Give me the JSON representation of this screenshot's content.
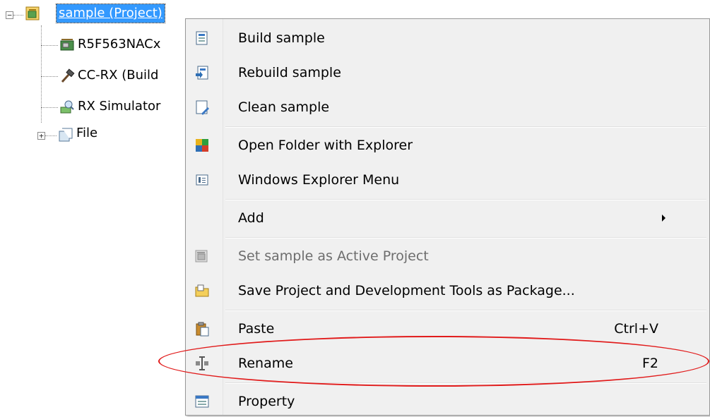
{
  "tree": {
    "root_label": "sample (Project)",
    "items": [
      {
        "label": "R5F563NACx",
        "icon": "chip-icon"
      },
      {
        "label": "CC-RX (Build",
        "icon": "hammer-icon"
      },
      {
        "label": "RX Simulator",
        "icon": "debugger-icon"
      },
      {
        "label": "File",
        "icon": "folder-file-icon"
      }
    ],
    "collapse_glyph": "−",
    "expand_glyph": "+"
  },
  "context_menu": {
    "items": [
      {
        "label": "Build sample",
        "icon": "build-icon",
        "enabled": true
      },
      {
        "label": "Rebuild sample",
        "icon": "rebuild-icon",
        "enabled": true
      },
      {
        "label": "Clean sample",
        "icon": "clean-icon",
        "enabled": true
      },
      {
        "label": "Open Folder with Explorer",
        "icon": "explorer-folder-icon",
        "enabled": true
      },
      {
        "label": "Windows Explorer Menu",
        "icon": "explorer-menu-icon",
        "enabled": true
      },
      {
        "label": "Add",
        "icon": null,
        "enabled": true,
        "submenu": true
      },
      {
        "label": "Set sample as Active Project",
        "icon": "active-project-icon",
        "enabled": false
      },
      {
        "label": "Save Project and Development Tools as Package...",
        "icon": "package-icon",
        "enabled": true
      },
      {
        "label": "Paste",
        "icon": "paste-icon",
        "enabled": true,
        "shortcut": "Ctrl+V"
      },
      {
        "label": "Rename",
        "icon": "rename-icon",
        "enabled": true,
        "shortcut": "F2",
        "highlighted": true
      },
      {
        "label": "Property",
        "icon": "property-icon",
        "enabled": true
      }
    ],
    "highlight_color": "#e11b1b",
    "selection_color": "#3399ff"
  }
}
